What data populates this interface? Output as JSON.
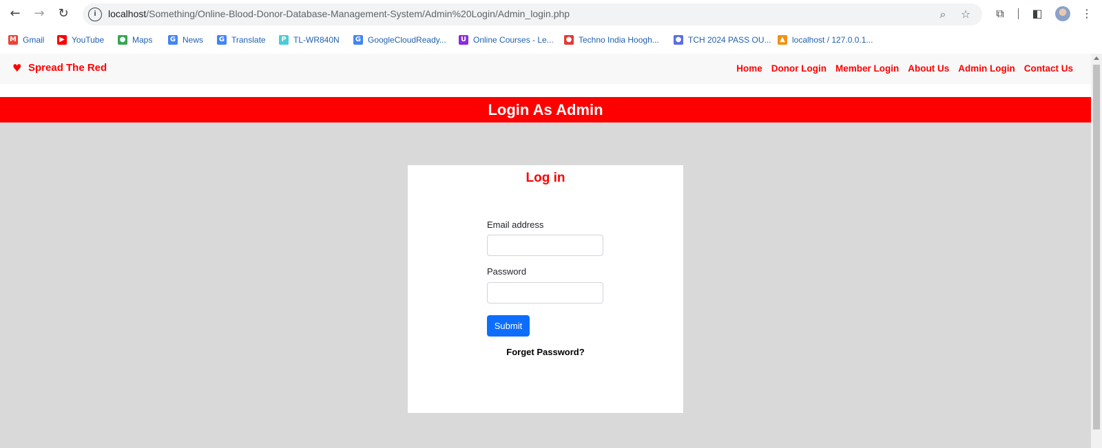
{
  "browser": {
    "url_host": "localhost",
    "url_path": "/Something/Online-Blood-Donor-Database-Management-System/Admin%20Login/Admin_login.php",
    "bookmarks": [
      {
        "label": "Gmail",
        "icon": "gmail-icon",
        "color": "#ea4335",
        "glyph": "M"
      },
      {
        "label": "YouTube",
        "icon": "youtube-icon",
        "color": "#ff0000",
        "glyph": "▶"
      },
      {
        "label": "Maps",
        "icon": "maps-icon",
        "color": "#34a853",
        "glyph": "●"
      },
      {
        "label": "News",
        "icon": "news-icon",
        "color": "#4285f4",
        "glyph": "G"
      },
      {
        "label": "Translate",
        "icon": "translate-icon",
        "color": "#4285f4",
        "glyph": "G"
      },
      {
        "label": "TL-WR840N",
        "icon": "tplink-icon",
        "color": "#4acbd6",
        "glyph": "P"
      },
      {
        "label": "GoogleCloudReady...",
        "icon": "google-icon",
        "color": "#4285f4",
        "glyph": "G"
      },
      {
        "label": "Online Courses - Le...",
        "icon": "courses-icon",
        "color": "#8a2be2",
        "glyph": "U"
      },
      {
        "label": "Techno India Hoogh...",
        "icon": "techno-icon",
        "color": "#e53935",
        "glyph": "●"
      },
      {
        "label": "TCH 2024 PASS OU...",
        "icon": "group-icon",
        "color": "#5b6ee1",
        "glyph": "●"
      },
      {
        "label": "localhost / 127.0.0.1...",
        "icon": "phpmyadmin-icon",
        "color": "#f29111",
        "glyph": "▲"
      }
    ]
  },
  "site": {
    "brand": "Spread The Red",
    "menu": [
      "Home",
      "Donor Login",
      "Member Login",
      "About Us",
      "Admin Login",
      "Contact Us"
    ],
    "banner": "Login As Admin",
    "accent": "#ff0000"
  },
  "login": {
    "title": "Log in",
    "email_label": "Email address",
    "email_value": "",
    "password_label": "Password",
    "password_value": "",
    "submit_label": "Submit",
    "forget_label": "Forget Password?"
  }
}
